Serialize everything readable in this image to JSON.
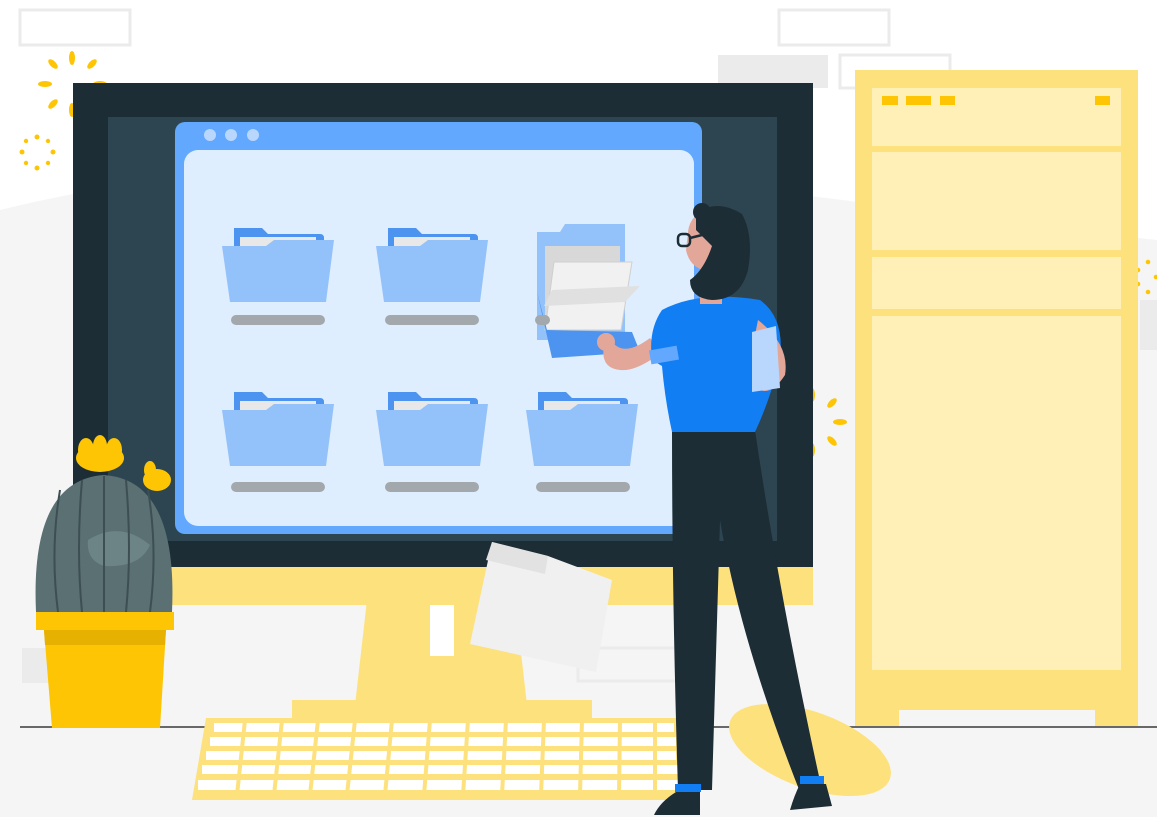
{
  "scene": {
    "subject": "person-browsing-folders-on-computer",
    "colors": {
      "monitor_frame": "#1d2d35",
      "monitor_inner": "#2d4550",
      "window_blue": "#62a8fe",
      "window_bg": "#dfeefe",
      "folder_front": "#93c2fb",
      "folder_back": "#4c94f0",
      "label_gray": "#a3a8ad",
      "stand_yellow": "#fde07a",
      "cabinet_yellow": "#fde17d",
      "cabinet_panel": "#fef0b7",
      "accent_yellow": "#fdc504",
      "shirt_blue": "#127ef4",
      "skin": "#e3a79a",
      "cactus": "#5a7073",
      "pot": "#fdc504"
    },
    "icons": [
      "folder-icon",
      "window-dot-icon",
      "sparkle-icon",
      "cactus-icon",
      "keyboard-icon"
    ]
  }
}
